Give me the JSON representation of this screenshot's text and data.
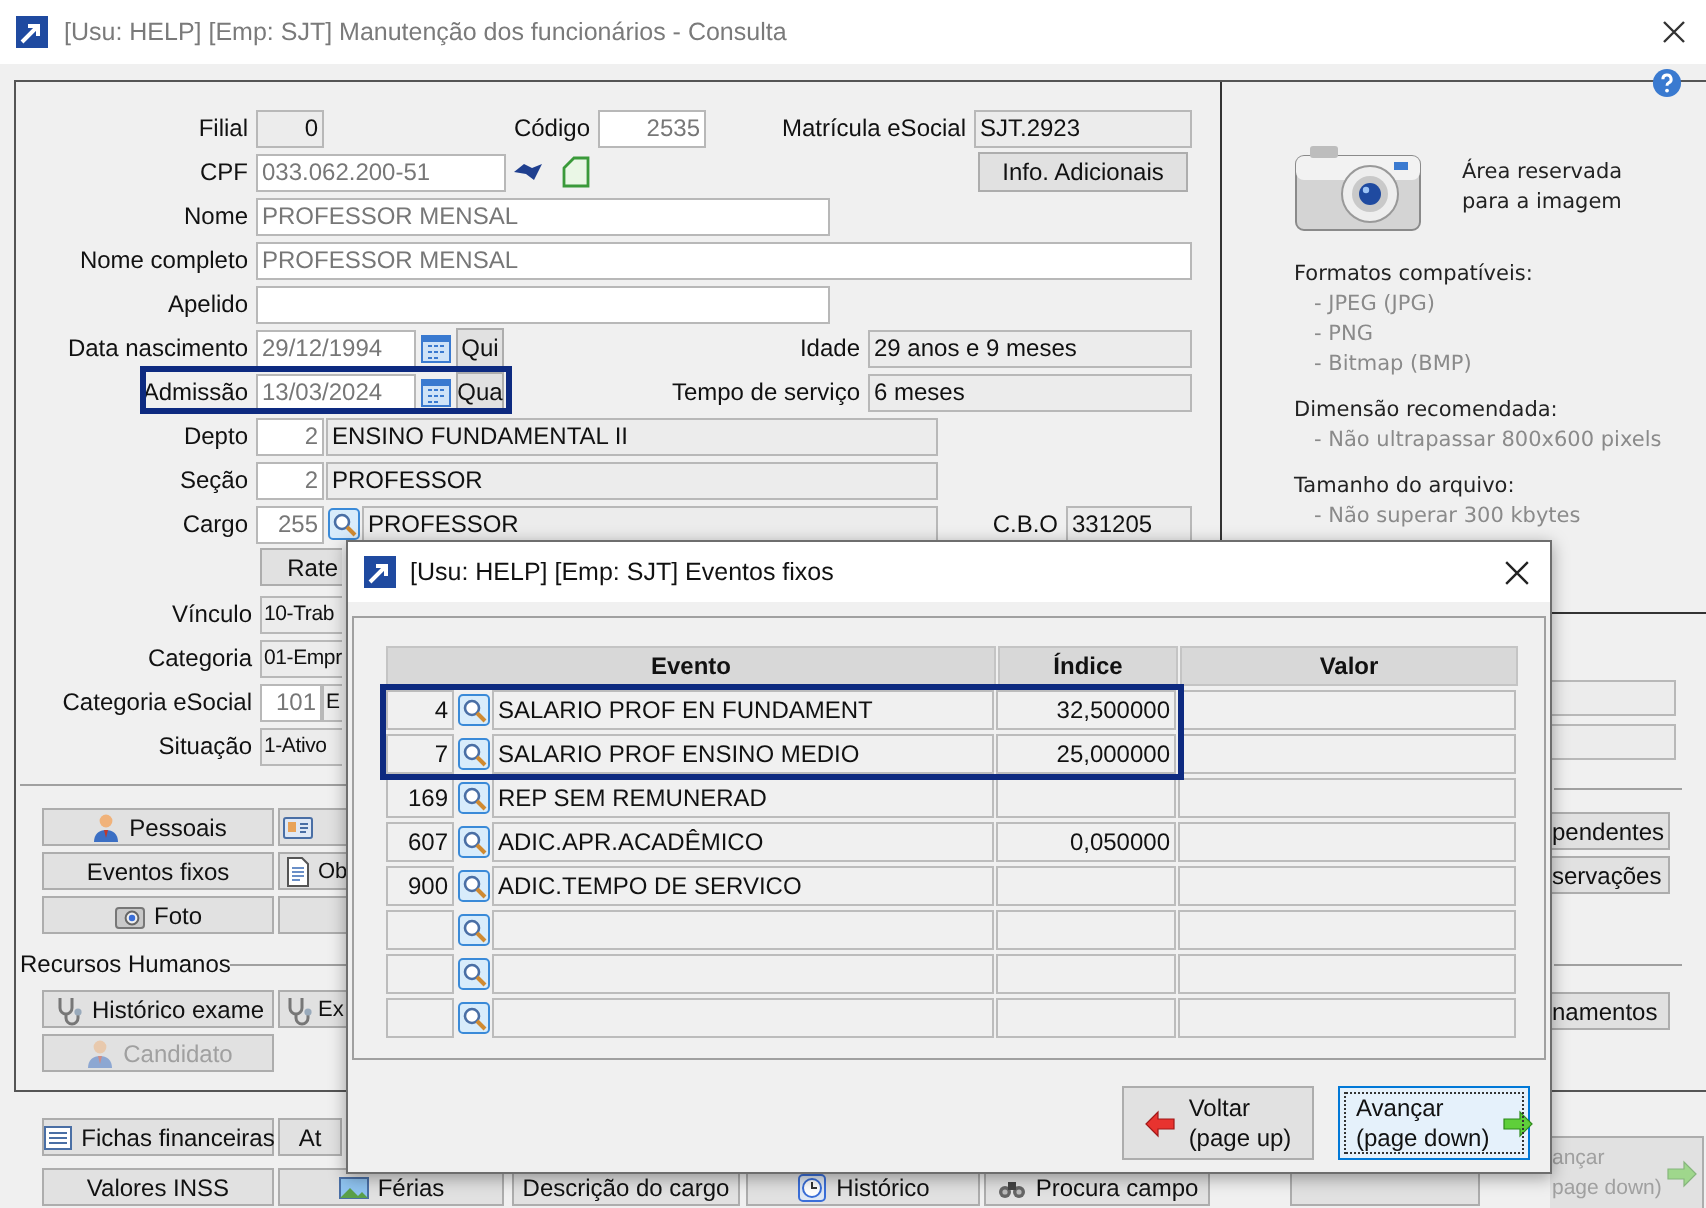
{
  "window": {
    "title": "[Usu: HELP] [Emp: SJT] Manutenção dos funcionários - Consulta"
  },
  "form": {
    "filial": {
      "label": "Filial",
      "value": "0"
    },
    "codigo": {
      "label": "Código",
      "value": "2535"
    },
    "matricula": {
      "label": "Matrícula eSocial",
      "value": "SJT.2923"
    },
    "cpf": {
      "label": "CPF",
      "value": "033.062.200-51"
    },
    "info_button": "Info. Adicionais",
    "nome": {
      "label": "Nome",
      "value": "PROFESSOR MENSAL"
    },
    "nome_completo": {
      "label": "Nome completo",
      "value": "PROFESSOR MENSAL"
    },
    "apelido": {
      "label": "Apelido"
    },
    "data_nascimento": {
      "label": "Data nascimento",
      "value": "29/12/1994",
      "weekday": "Qui",
      "highlighted": false
    },
    "idade": {
      "label": "Idade",
      "value": "29 anos e 9 meses"
    },
    "admissao": {
      "label": "Admissão",
      "value": "13/03/2024",
      "weekday": "Qua",
      "highlighted": true
    },
    "tempo_servico": {
      "label": "Tempo de serviço",
      "value": "6 meses"
    },
    "depto": {
      "label": "Depto",
      "code": "2",
      "name": "ENSINO FUNDAMENTAL II"
    },
    "secao": {
      "label": "Seção",
      "code": "2",
      "name": "PROFESSOR"
    },
    "cargo": {
      "label": "Cargo",
      "code": "255",
      "name": "PROFESSOR"
    },
    "cbo": {
      "label": "C.B.O",
      "value": "331205"
    },
    "rate_button": "Rate",
    "vinculo": {
      "label": "Vínculo",
      "value": "10-Trab"
    },
    "categoria": {
      "label": "Categoria",
      "value": "01-Empr"
    },
    "categoria_esocial": {
      "label": "Categoria eSocial",
      "code": "101",
      "value": "E"
    },
    "situacao": {
      "label": "Situação",
      "value": "1-Ativo"
    }
  },
  "image_panel": {
    "caption": [
      "Área reservada",
      "para a imagem"
    ],
    "sections": [
      {
        "title": "Formatos compatíveis:",
        "items": [
          "- JPEG (JPG)",
          "- PNG",
          "- Bitmap (BMP)"
        ]
      },
      {
        "title": "Dimensão recomendada:",
        "items": [
          "- Não ultrapassar 800x600 pixels"
        ]
      },
      {
        "title": "Tamanho do arquivo:",
        "items": [
          "- Não superar 300 kbytes"
        ]
      }
    ]
  },
  "buttons": {
    "main": [
      {
        "label": "Pessoais",
        "kind": "person",
        "disabled": false
      },
      {
        "label": "Eventos fixos",
        "disabled": false
      },
      {
        "label": "Foto",
        "kind": "camera",
        "disabled": false
      }
    ],
    "side": [
      {
        "kind": "card",
        "disabled": false
      },
      {
        "label": "Ob",
        "kind": "document",
        "disabled": false
      }
    ]
  },
  "recursos_humanos": {
    "title": "Recursos Humanos",
    "main": [
      {
        "label": "Histórico exame",
        "kind": "stethoscope",
        "disabled": false
      },
      {
        "label": "Candidato",
        "kind": "person",
        "disabled": true
      }
    ],
    "side": [
      {
        "label": "Ex",
        "kind": "stethoscope",
        "disabled": false
      }
    ]
  },
  "right_buttons": [
    {
      "label": "pendentes"
    },
    {
      "label": "servações"
    },
    {
      "label": "namentos"
    }
  ],
  "bottom_buttons": [
    [
      {
        "label": "Fichas financeiras",
        "kind": "list"
      },
      {
        "label": "At"
      }
    ],
    [
      {
        "label": "Valores INSS"
      },
      {
        "label": "Férias",
        "kind": "picture"
      },
      {
        "label": "Descrição do cargo"
      },
      {
        "label": "Histórico",
        "kind": "clock"
      },
      {
        "label": "Procura campo",
        "kind": "binoculars"
      }
    ]
  ],
  "side_button": {
    "label": "ançar",
    "sub": "page down)",
    "disabled": true
  },
  "dialog": {
    "title": "[Usu: HELP] [Emp: SJT] Eventos fixos",
    "columns": [
      "Evento",
      "Índice",
      "Valor"
    ],
    "rows": [
      {
        "code": "4",
        "event": "SALARIO PROF EN FUNDAMENT",
        "indice": "32,500000",
        "highlighted": true
      },
      {
        "code": "7",
        "event": "SALARIO PROF ENSINO MEDIO",
        "indice": "25,000000",
        "highlighted": true
      },
      {
        "code": "169",
        "event": "REP SEM REMUNERAD",
        "highlighted": false
      },
      {
        "code": "607",
        "event": "ADIC.APR.ACADÊMICO",
        "indice": "0,050000",
        "highlighted": false
      },
      {
        "code": "900",
        "event": "ADIC.TEMPO DE SERVICO",
        "highlighted": false
      },
      {
        "highlighted": false
      },
      {
        "highlighted": false
      },
      {
        "highlighted": false
      }
    ],
    "buttons": [
      {
        "label": "Voltar",
        "sub": "(page up)",
        "focused": false
      },
      {
        "label": "Avançar",
        "sub": "(page down)",
        "focused": true
      }
    ]
  }
}
